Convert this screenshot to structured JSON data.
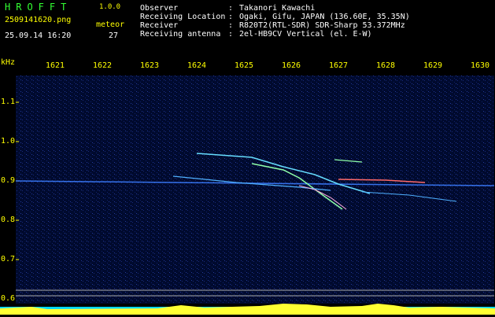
{
  "app": {
    "logo": "HROFFT",
    "version": "1.0.0"
  },
  "file": {
    "name": "2509141620.png",
    "datetime": "25.09.14 16:20"
  },
  "meteor": {
    "label": "meteor",
    "count": "27"
  },
  "info": [
    {
      "key": "Observer",
      "value": "Takanori Kawachi"
    },
    {
      "key": "Receiving Location",
      "value": "Ogaki, Gifu, JAPAN (136.60E, 35.35N)"
    },
    {
      "key": "Receiver",
      "value": "R820T2(RTL-SDR) SDR-Sharp 53.372MHz"
    },
    {
      "key": "Receiving antenna",
      "value": "2el-HB9CV Vertical (el. E-W)"
    }
  ],
  "freq_axis": {
    "unit": "kHz",
    "ticks": [
      "1621",
      "1622",
      "1623",
      "1624",
      "1625",
      "1626",
      "1627",
      "1628",
      "1629",
      "1630"
    ]
  },
  "y_axis": {
    "ticks": [
      "1.1",
      "1.0",
      "0.9",
      "0.8",
      "0.7",
      "0.6"
    ]
  },
  "colors": {
    "label": "#ffff00",
    "logo": "#33ff33",
    "background": "#000a2e",
    "text": "#ffffff"
  }
}
